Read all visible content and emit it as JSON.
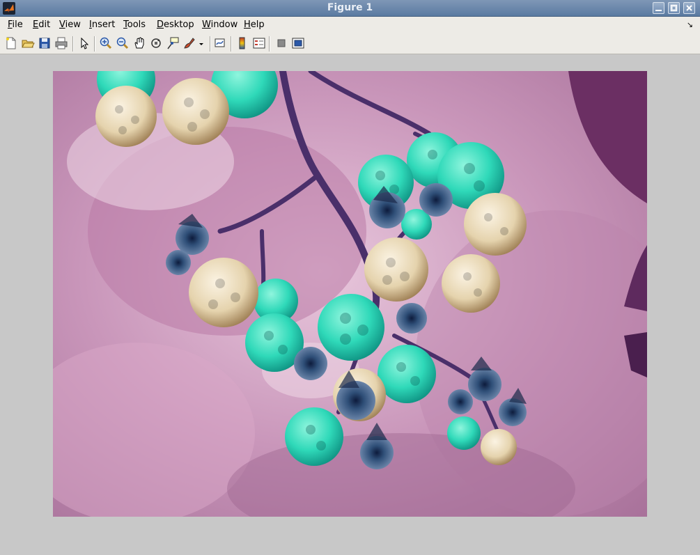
{
  "window": {
    "title": "Figure 1"
  },
  "menu": {
    "items": [
      {
        "first": "F",
        "rest": "ile"
      },
      {
        "first": "E",
        "rest": "dit"
      },
      {
        "first": "V",
        "rest": "iew"
      },
      {
        "first": "I",
        "rest": "nsert"
      },
      {
        "first": "T",
        "rest": "ools"
      },
      {
        "first": "D",
        "rest": "esktop"
      },
      {
        "first": "W",
        "rest": "indow"
      },
      {
        "first": "H",
        "rest": "elp"
      }
    ],
    "dock_glyph": "↘"
  },
  "toolbar": {
    "icons": [
      "new-figure-icon",
      "open-file-icon",
      "save-icon",
      "print-icon",
      "edit-plot-icon",
      "zoom-in-icon",
      "zoom-out-icon",
      "pan-icon",
      "rotate-3d-icon",
      "data-cursor-icon",
      "brush-icon",
      "link-plot-icon",
      "insert-colorbar-icon",
      "insert-legend-icon",
      "hide-plot-tools-icon",
      "show-plot-tools-icon"
    ]
  },
  "colors": {
    "background_pink": "#c98fb4",
    "cyan_berry": "#2fd9b9",
    "cream_berry": "#eadcc0",
    "stem_purple": "#4a2f6a"
  }
}
